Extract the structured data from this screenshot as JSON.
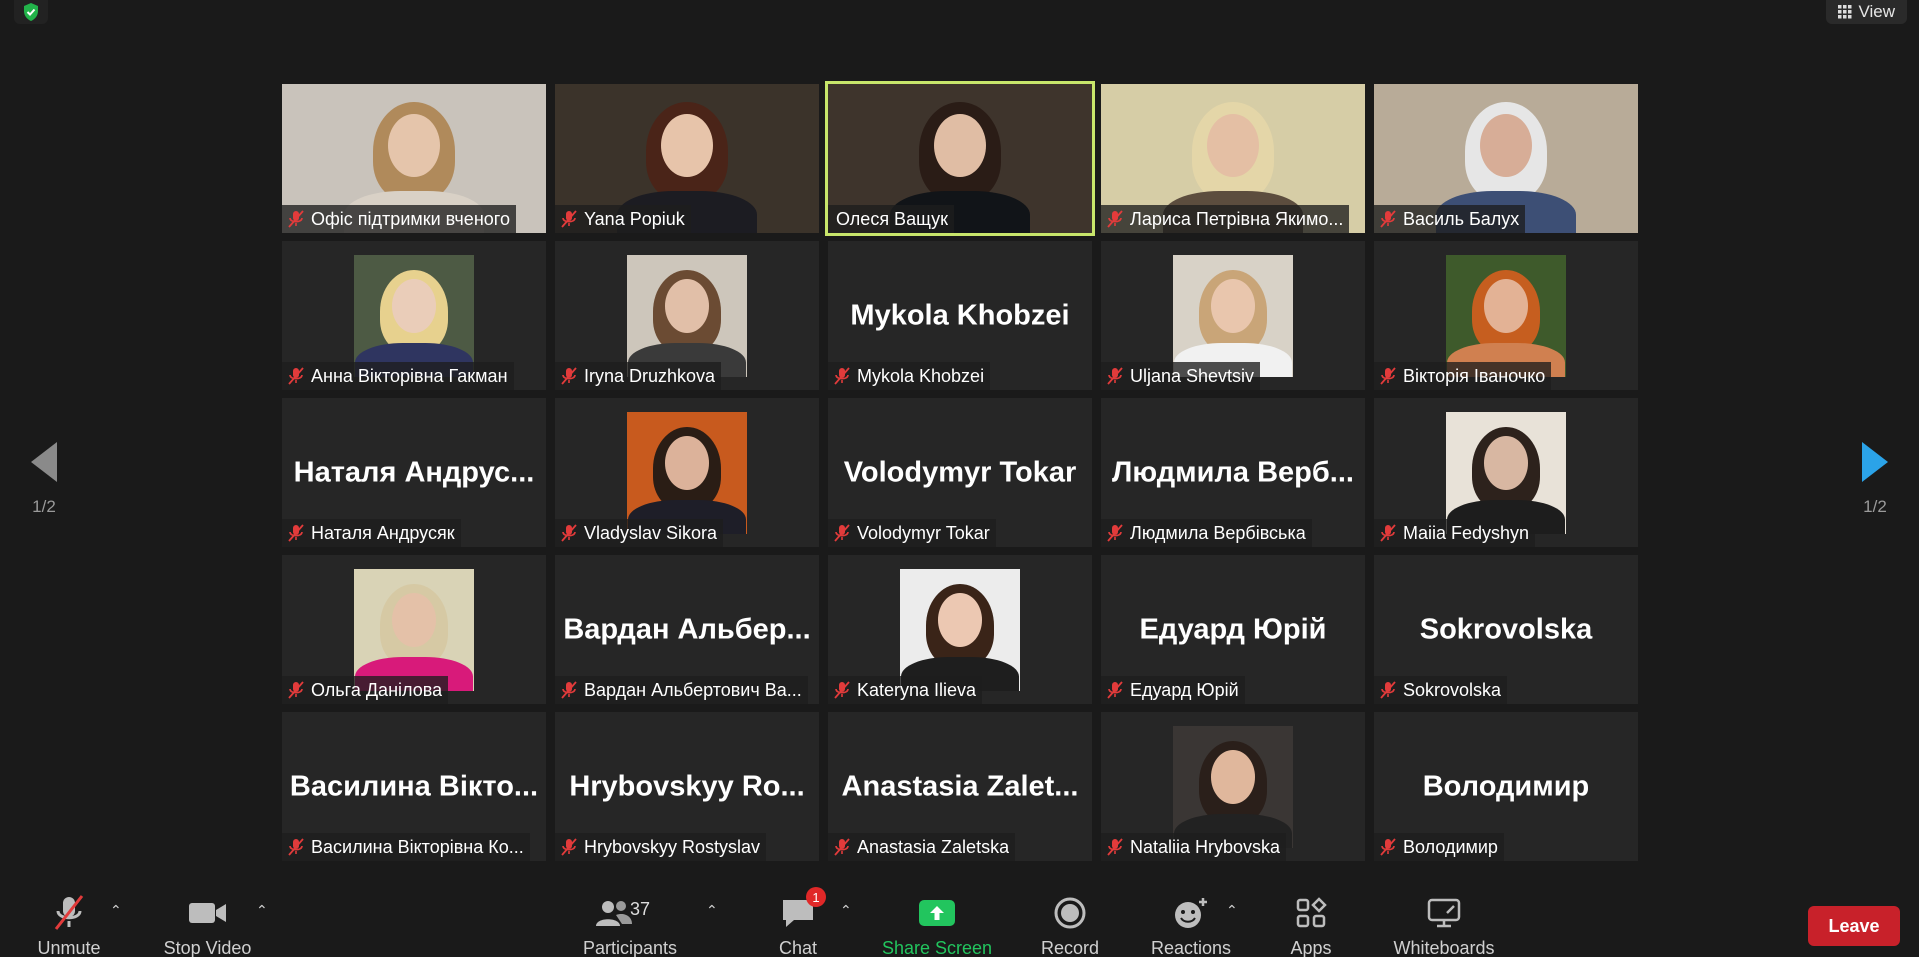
{
  "top_bar": {
    "security_icon": "shield-check-icon",
    "view_label": "View"
  },
  "tiles": [
    {
      "label": "Офіс підтримки вченого",
      "muted": true,
      "video": "full",
      "bg": "#c9c3bb",
      "skin": "#e5c5ab",
      "hair": "#b08a5b",
      "cloth": "#d9d1c6"
    },
    {
      "label": "Yana Popiuk",
      "muted": true,
      "video": "full",
      "bg": "#3b332a",
      "skin": "#e7c4aa",
      "hair": "#4a2418",
      "cloth": "#1c1c22"
    },
    {
      "label": "Олеся Ващук",
      "muted": false,
      "video": "full",
      "active": true,
      "bg": "#3e342c",
      "skin": "#e0bda4",
      "hair": "#2a1c16",
      "cloth": "#111418"
    },
    {
      "label": "Лариса Петрівна Якимо...",
      "muted": true,
      "video": "full",
      "bg": "#d6cda6",
      "skin": "#e4bfa4",
      "hair": "#e4d6a8",
      "cloth": "#5c4d3e"
    },
    {
      "label": "Василь Балух",
      "muted": true,
      "video": "full",
      "bg": "#b8ab98",
      "skin": "#d7ad97",
      "hair": "#e6e6e6",
      "cloth": "#3d4f75"
    },
    {
      "label": "Анна Вікторівна Гакман",
      "muted": true,
      "video": "thumb",
      "bg": "#4d5a44",
      "skin": "#eacdb9",
      "hair": "#e7d18e",
      "cloth": "#2f3560"
    },
    {
      "label": "Iryna Druzhkova",
      "muted": true,
      "video": "thumb",
      "bg": "#cdc6bb",
      "skin": "#e1bfa8",
      "hair": "#6b4b33",
      "cloth": "#3a3a3a"
    },
    {
      "label": "Mykola Khobzei",
      "muted": true,
      "video": "none",
      "name_display": "Mykola Khobzei"
    },
    {
      "label": "Uljana Shevtsiv",
      "muted": true,
      "video": "thumb",
      "bg": "#d8d2c7",
      "skin": "#e9c6ad",
      "hair": "#c9a578",
      "cloth": "#f1f1f1"
    },
    {
      "label": "Вікторія Іваночко",
      "muted": true,
      "video": "thumb",
      "bg": "#3e5a2b",
      "skin": "#e3b295",
      "hair": "#c65e1f",
      "cloth": "#d08050"
    },
    {
      "label": "Наталя Андрусяк",
      "muted": true,
      "video": "none",
      "name_display": "Наталя  Андрус..."
    },
    {
      "label": "Vladyslav Sikora",
      "muted": true,
      "video": "thumb",
      "bg": "#c85a1e",
      "skin": "#dcb29a",
      "hair": "#2a1d15",
      "cloth": "#1e1e28"
    },
    {
      "label": "Volodymyr Tokar",
      "muted": true,
      "video": "none",
      "name_display": "Volodymyr Tokar"
    },
    {
      "label": "Людмила Вербівська",
      "muted": true,
      "video": "none",
      "name_display": "Людмила  Верб..."
    },
    {
      "label": "Maiia Fedyshyn",
      "muted": true,
      "video": "thumb",
      "bg": "#e8e2d8",
      "skin": "#d8b7a2",
      "hair": "#2d221c",
      "cloth": "#1d1d1d"
    },
    {
      "label": "Ольга Данілова",
      "muted": true,
      "video": "thumb",
      "bg": "#d9d3b6",
      "skin": "#e4c1a8",
      "hair": "#d6c9a4",
      "cloth": "#d81a7a"
    },
    {
      "label": "Вардан Альбертович Ва...",
      "muted": true,
      "video": "none",
      "name_display": "Вардан  Альбер..."
    },
    {
      "label": "Kateryna Ilieva",
      "muted": true,
      "video": "thumb",
      "bg": "#ececec",
      "skin": "#ecc8b2",
      "hair": "#3a2418",
      "cloth": "#1e1e1e"
    },
    {
      "label": "Едуард Юрій",
      "muted": true,
      "video": "none",
      "name_display": "Едуард Юрій"
    },
    {
      "label": "Sokrovolska",
      "muted": true,
      "video": "none",
      "name_display": "Sokrovolska"
    },
    {
      "label": "Василина Вікторівна Ко...",
      "muted": true,
      "video": "none",
      "name_display": "Василина  Вікто..."
    },
    {
      "label": "Hrybovskyy Rostyslav",
      "muted": true,
      "video": "none",
      "name_display": "Hrybovskyy  Ro..."
    },
    {
      "label": "Anastasia Zaletska",
      "muted": true,
      "video": "none",
      "name_display": "Anastasia  Zalet..."
    },
    {
      "label": "Nataliia Hrybovska",
      "muted": true,
      "video": "thumb",
      "bg": "#3a3634",
      "skin": "#e0b79c",
      "hair": "#2a1f1a",
      "cloth": "#222"
    },
    {
      "label": "Володимир",
      "muted": true,
      "video": "none",
      "name_display": "Володимир"
    }
  ],
  "pager": {
    "left": "1/2",
    "right": "1/2"
  },
  "toolbar": {
    "unmute": "Unmute",
    "stop_video": "Stop Video",
    "participants": "Participants",
    "participants_count": "37",
    "chat": "Chat",
    "chat_badge": "1",
    "share_screen": "Share Screen",
    "record": "Record",
    "reactions": "Reactions",
    "apps": "Apps",
    "whiteboards": "Whiteboards",
    "leave": "Leave"
  },
  "colors": {
    "background": "#1a1a1a",
    "tile": "#262626",
    "active_speaker": "#c8e66b",
    "share_green": "#22c55e",
    "leave_red": "#c8212a",
    "nav_arrow_active": "#2ba3e8",
    "nav_arrow_inactive": "#8a8a8a"
  }
}
